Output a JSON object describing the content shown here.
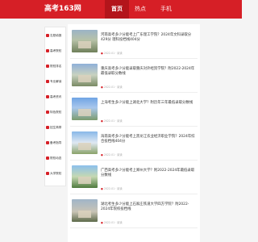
{
  "header": {
    "logo": "高考163网",
    "nav": [
      {
        "label": "首页"
      },
      {
        "label": "热点"
      },
      {
        "label": "手机"
      }
    ]
  },
  "sidebar": {
    "items": [
      {
        "label": "志愿填报"
      },
      {
        "label": "高考院校"
      },
      {
        "label": "院校排名"
      },
      {
        "label": "专业解读"
      },
      {
        "label": "高考资讯"
      },
      {
        "label": "特色院校"
      },
      {
        "label": "招生简章"
      },
      {
        "label": "备考指导"
      },
      {
        "label": "院校动态"
      },
      {
        "label": "大学院校"
      }
    ]
  },
  "articles": [
    {
      "title": "河南高考多少分能考上广东理工学院？2024年文科录取分429分 理科投档线404分",
      "meta": "2022-01 · 阅读"
    },
    {
      "title": "重庆高考多少分能录取重庆对外经贸学院？附2022-2024年最低录取分数线",
      "meta": "2022-01 · 阅读"
    },
    {
      "title": "上海考生多少分能上湖北大学？附历年三年最低录取分数线",
      "meta": "2022-01 · 阅读"
    },
    {
      "title": "海南高考多少分能考上黑龙江农业经济职业学院？2024年综合投档线404分",
      "meta": "2022-01 · 阅读"
    },
    {
      "title": "广西高考多少分能考上郑州大学？附2022-2024年最低录取分数线",
      "meta": "2022-01 · 阅读"
    },
    {
      "title": "湖北考生多少分能上石家庄铁道大学四方学院？附2022-2024年院校投档线",
      "meta": "2022-01 · 阅读"
    }
  ],
  "colors": {
    "brand": "#d61f26"
  }
}
